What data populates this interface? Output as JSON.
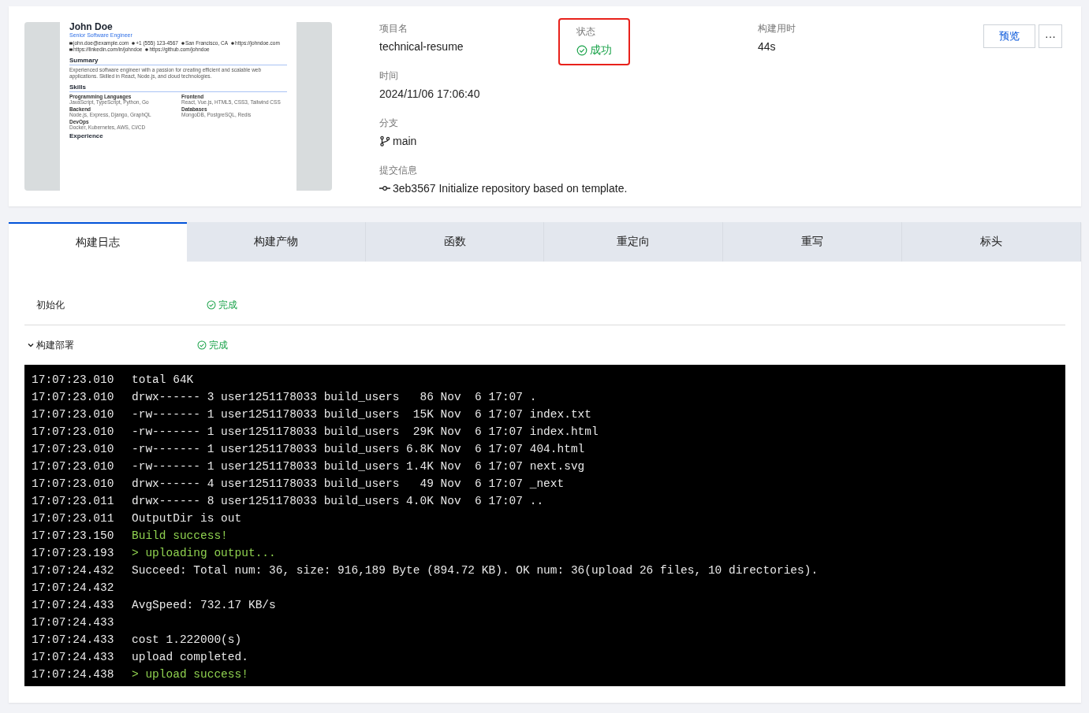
{
  "preview": {
    "name": "John Doe",
    "role": "Senior Software Engineer",
    "contacts": [
      {
        "kind": "mail",
        "text": "john.doe@example.com"
      },
      {
        "kind": "phone",
        "text": "+1 (555) 123-4567"
      },
      {
        "kind": "pin",
        "text": "San Francisco, CA"
      },
      {
        "kind": "globe",
        "text": "https://johndoe.com"
      },
      {
        "kind": "linkedin",
        "text": "https://linkedin.com/in/johndoe"
      },
      {
        "kind": "github",
        "text": "https://github.com/johndoe"
      }
    ],
    "summary_title": "Summary",
    "summary": "Experienced software engineer with a passion for creating efficient and scalable web applications. Skilled in React, Node.js, and cloud technologies.",
    "skills_title": "Skills",
    "skills": [
      {
        "title": "Programming Languages",
        "text": "JavaScript, TypeScript, Python, Go"
      },
      {
        "title": "Frontend",
        "text": "React, Vue.js, HTML5, CSS3, Tailwind CSS"
      },
      {
        "title": "Backend",
        "text": "Node.js, Express, Django, GraphQL"
      },
      {
        "title": "Databases",
        "text": "MongoDB, PostgreSQL, Redis"
      },
      {
        "title": "DevOps",
        "text": "Docker, Kubernetes, AWS, CI/CD"
      }
    ],
    "next_title": "Experience"
  },
  "info": {
    "project": {
      "label": "项目名",
      "value": "technical-resume"
    },
    "status": {
      "label": "状态",
      "value": "成功",
      "kind": "success",
      "highlighted": true
    },
    "duration": {
      "label": "构建用时",
      "value": "44s"
    },
    "time": {
      "label": "时间",
      "value": "2024/11/06 17:06:40"
    },
    "branch": {
      "label": "分支",
      "value": "main"
    },
    "commit": {
      "label": "提交信息",
      "value": "3eb3567 Initialize repository based on template."
    }
  },
  "actions": {
    "preview": "预览",
    "more": "···"
  },
  "tabs": [
    {
      "label": "构建日志",
      "selected": true
    },
    {
      "label": "构建产物",
      "selected": false
    },
    {
      "label": "函数",
      "selected": false
    },
    {
      "label": "重定向",
      "selected": false
    },
    {
      "label": "重写",
      "selected": false
    },
    {
      "label": "标头",
      "selected": false
    }
  ],
  "steps": [
    {
      "name": "初始化",
      "status": "完成",
      "expanded": false
    },
    {
      "name": "构建部署",
      "status": "完成",
      "expanded": true
    }
  ],
  "log": [
    {
      "time": "17:07:23.010",
      "text": "total 64K",
      "kind": "normal"
    },
    {
      "time": "17:07:23.010",
      "text": "drwx------ 3 user1251178033 build_users   86 Nov  6 17:07 .",
      "kind": "normal"
    },
    {
      "time": "17:07:23.010",
      "text": "-rw------- 1 user1251178033 build_users  15K Nov  6 17:07 index.txt",
      "kind": "normal"
    },
    {
      "time": "17:07:23.010",
      "text": "-rw------- 1 user1251178033 build_users  29K Nov  6 17:07 index.html",
      "kind": "normal"
    },
    {
      "time": "17:07:23.010",
      "text": "-rw------- 1 user1251178033 build_users 6.8K Nov  6 17:07 404.html",
      "kind": "normal"
    },
    {
      "time": "17:07:23.010",
      "text": "-rw------- 1 user1251178033 build_users 1.4K Nov  6 17:07 next.svg",
      "kind": "normal"
    },
    {
      "time": "17:07:23.010",
      "text": "drwx------ 4 user1251178033 build_users   49 Nov  6 17:07 _next",
      "kind": "normal"
    },
    {
      "time": "17:07:23.011",
      "text": "drwx------ 8 user1251178033 build_users 4.0K Nov  6 17:07 ..",
      "kind": "normal"
    },
    {
      "time": "17:07:23.011",
      "text": "OutputDir is out",
      "kind": "normal"
    },
    {
      "time": "17:07:23.150",
      "text": "Build success!",
      "kind": "success"
    },
    {
      "time": "17:07:23.193",
      "text": "> uploading output...",
      "kind": "success"
    },
    {
      "time": "17:07:24.432",
      "text": "Succeed: Total num: 36, size: 916,189 Byte (894.72 KB). OK num: 36(upload 26 files, 10 directories).",
      "kind": "normal"
    },
    {
      "time": "17:07:24.432",
      "kind": "normal"
    },
    {
      "time": "17:07:24.433",
      "text": "AvgSpeed: 732.17 KB/s",
      "kind": "normal"
    },
    {
      "time": "17:07:24.433",
      "kind": "normal"
    },
    {
      "time": "17:07:24.433",
      "text": "cost 1.222000(s)",
      "kind": "normal"
    },
    {
      "time": "17:07:24.433",
      "text": "upload completed.",
      "kind": "normal"
    },
    {
      "time": "17:07:24.438",
      "text": "> upload success!",
      "kind": "success"
    }
  ]
}
